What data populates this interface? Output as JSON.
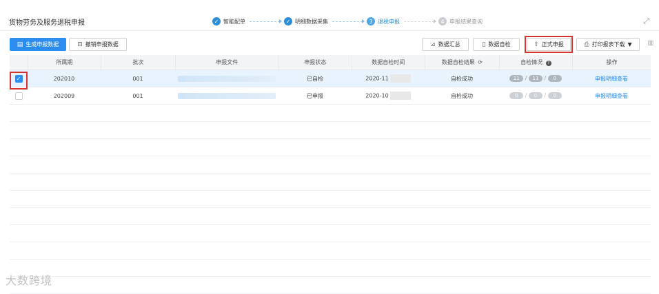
{
  "page": {
    "title": "货物劳务及服务退税申报"
  },
  "steps": [
    {
      "label": "智能配单",
      "state": "done",
      "marker": "✓"
    },
    {
      "label": "明细数据采集",
      "state": "done",
      "marker": "✓"
    },
    {
      "label": "退税申报",
      "state": "active",
      "marker": "3"
    },
    {
      "label": "申报结果查询",
      "state": "todo",
      "marker": "4"
    }
  ],
  "toolbar": {
    "generate_label": "生成申报数据",
    "revoke_label": "撤销申报数据",
    "summary_label": "数据汇总",
    "selfcheck_label": "数据自检",
    "formal_label": "正式申报",
    "print_label": "打印报表下载"
  },
  "icons": {
    "generate": "form-icon",
    "revoke": "revoke-icon",
    "summary": "chart-icon",
    "selfcheck": "document-icon",
    "formal": "upload-icon",
    "print": "printer-icon",
    "dropdown": "caret-down-icon",
    "fullscreen": "fullscreen-icon",
    "refresh": "refresh-icon",
    "help": "help-icon",
    "columns": "columns-icon"
  },
  "table": {
    "headers": [
      "所属期",
      "批次",
      "申报文件",
      "申报状态",
      "数据自检时间",
      "数据自检结果",
      "自检情况",
      "操作"
    ],
    "rows": [
      {
        "period": "202010",
        "batch": "001",
        "status": "已自检",
        "time": "2020-11",
        "result": "自检成功",
        "counts": [
          "11",
          "11",
          "0"
        ],
        "action": "申报明细查看",
        "checked": true
      },
      {
        "period": "202009",
        "batch": "001",
        "status": "已申报",
        "time": "2020-10",
        "result": "自检成功",
        "counts": [
          "0",
          "0",
          "0"
        ],
        "action": "申报明细查看",
        "checked": false
      }
    ]
  },
  "colors": {
    "primary": "#2d8cf0",
    "highlight": "#d7342e"
  },
  "watermark": "大数跨境"
}
